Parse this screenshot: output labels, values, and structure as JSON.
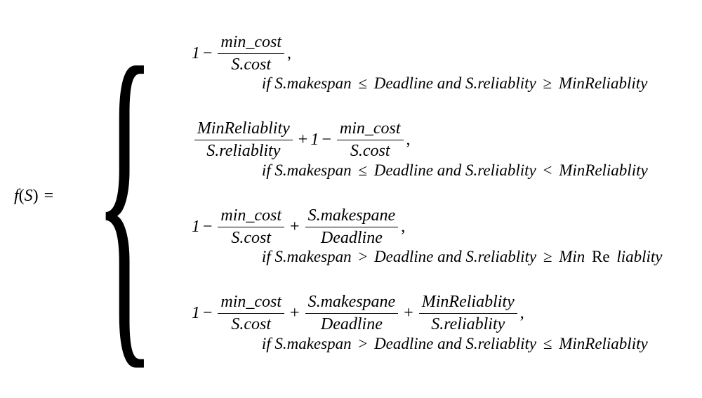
{
  "chart_data": {
    "type": "table",
    "title": "Piecewise function f(S) definition",
    "function_name": "f(S)",
    "cases": [
      {
        "expression": "1 - (min_cost / S.cost)",
        "condition": "S.makespan ≤ Deadline and S.reliablity ≥ MinReliablity"
      },
      {
        "expression": "(MinReliablity / S.reliablity) + 1 - (min_cost / S.cost)",
        "condition": "S.makespan ≤ Deadline and S.reliablity < MinReliablity"
      },
      {
        "expression": "1 - (min_cost / S.cost) + (S.makespane / Deadline)",
        "condition": "S.makespan > Deadline and S.reliablity ≥ Min Re liablity"
      },
      {
        "expression": "1 - (min_cost / S.cost) + (S.makespane / Deadline) + (MinReliablity / S.reliablity)",
        "condition": "S.makespan > Deadline and S.reliablity ≤ MinReliablity"
      }
    ]
  },
  "lhs": {
    "func": "f",
    "arg": "S"
  },
  "equals": "=",
  "case1": {
    "one": "1",
    "minus": "−",
    "frac1_num": "min_cost",
    "frac1_den": "S.cost",
    "comma": ",",
    "cond_if": "if ",
    "cond_sm": "S.makespan",
    "cond_le": "≤",
    "cond_dl": "Deadline and S.reliablity",
    "cond_ge": "≥",
    "cond_mr": "MinReliablity"
  },
  "case2": {
    "frac1_num": "MinReliablity",
    "frac1_den": "S.reliablity",
    "plus": "+",
    "one": "1",
    "minus": "−",
    "frac2_num": "min_cost",
    "frac2_den": "S.cost",
    "comma": ",",
    "cond_if": "if ",
    "cond_sm": "S.makespan",
    "cond_le": "≤",
    "cond_dl": "Deadline and S.reliablity",
    "cond_lt": "<",
    "cond_mr": "MinReliablity"
  },
  "case3": {
    "one": "1",
    "minus": "−",
    "frac1_num": "min_cost",
    "frac1_den": "S.cost",
    "plus": "+",
    "frac2_num": "S.makespane",
    "frac2_den": "Deadline",
    "comma": ",",
    "cond_if": "if ",
    "cond_sm": "S.makespan",
    "cond_gt": ">",
    "cond_dl": "Deadline and S.reliablity",
    "cond_ge": "≥",
    "cond_min": "Min",
    "cond_re": "Re",
    "cond_li": "liablity"
  },
  "case4": {
    "one": "1",
    "minus": "−",
    "frac1_num": "min_cost",
    "frac1_den": "S.cost",
    "plus1": "+",
    "frac2_num": "S.makespane",
    "frac2_den": "Deadline",
    "plus2": "+",
    "frac3_num": "MinReliablity",
    "frac3_den": "S.reliablity",
    "comma": ",",
    "cond_if": "if ",
    "cond_sm": "S.makespan",
    "cond_gt": ">",
    "cond_dl": "Deadline and S.reliablity",
    "cond_le": "≤",
    "cond_mr": "MinReliablity"
  }
}
